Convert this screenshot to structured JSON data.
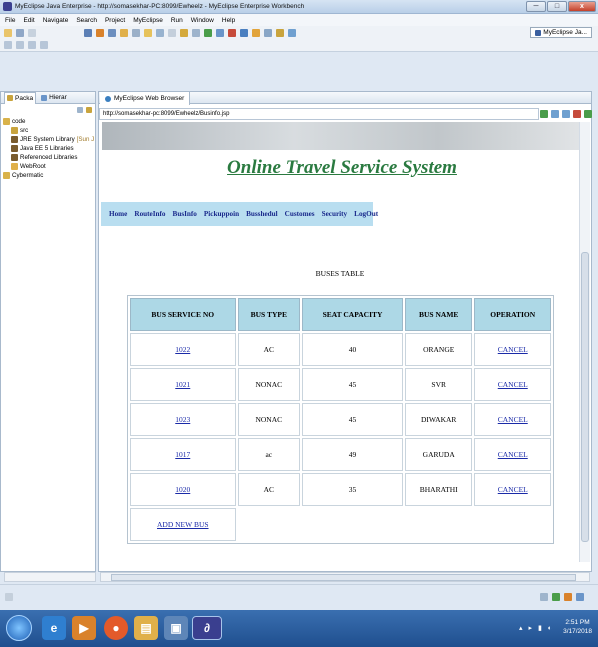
{
  "window": {
    "title": "MyEclipse Java Enterprise - http://somasekhar-PC:8099/Ewheelz - MyEclipse Enterprise Workbench",
    "min": "─",
    "max": "□",
    "close": "x"
  },
  "menu": [
    "File",
    "Edit",
    "Navigate",
    "Search",
    "Project",
    "MyEclipse",
    "Run",
    "Window",
    "Help"
  ],
  "perspective": {
    "label": "MyEclipse Ja..."
  },
  "left_panel": {
    "tabs": [
      "Packa",
      "Hierar"
    ],
    "tree": [
      {
        "label": "code",
        "suffix": ""
      },
      {
        "label": "src",
        "suffix": ""
      },
      {
        "label": "JRE System Library",
        "suffix": "[Sun J"
      },
      {
        "label": "Java EE 5 Libraries",
        "suffix": ""
      },
      {
        "label": "Referenced Libraries",
        "suffix": ""
      },
      {
        "label": "WebRoot",
        "suffix": ""
      },
      {
        "label": "Cybermatic",
        "suffix": ""
      }
    ]
  },
  "browser": {
    "tab_label": "MyEclipse Web Browser",
    "url": "http://somasekhar-pc:8099/Ewheelz/Businfo.jsp"
  },
  "site": {
    "title": "Online Travel Service System",
    "nav": [
      "Home",
      "RouteInfo",
      "BusInfo",
      "Pickuppoin",
      "Busshedul",
      "Customes",
      "Security",
      "LogOut"
    ]
  },
  "table": {
    "caption": "BUSES TABLE",
    "headers": [
      "BUS SERVICE NO",
      "BUS TYPE",
      "SEAT CAPACITY",
      "BUS NAME",
      "OPERATION"
    ],
    "rows": [
      [
        "1022",
        "AC",
        "40",
        "ORANGE",
        "CANCEL"
      ],
      [
        "1021",
        "NONAC",
        "45",
        "SVR",
        "CANCEL"
      ],
      [
        "1023",
        "NONAC",
        "45",
        "DIWAKAR",
        "CANCEL"
      ],
      [
        "1017",
        "ac",
        "49",
        "GARUDA",
        "CANCEL"
      ],
      [
        "1020",
        "AC",
        "35",
        "BHARATHI",
        "CANCEL"
      ]
    ],
    "add_link": "ADD NEW BUS"
  },
  "taskbar": {
    "time": "2:51 PM",
    "date": "3/17/2018"
  },
  "colors": {
    "title_green": "#2a7a40",
    "nav_bg": "#b9def0",
    "header_bg": "#add8e6",
    "link": "#1a2aa8"
  }
}
